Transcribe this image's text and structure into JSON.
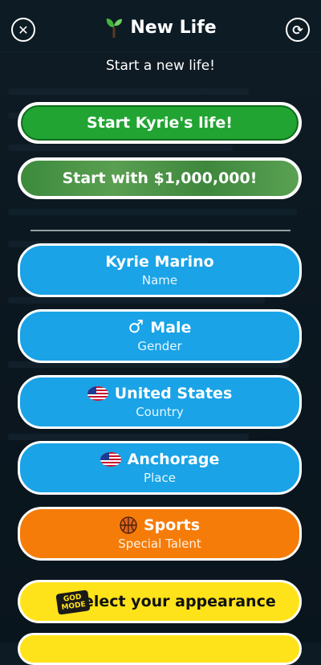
{
  "header": {
    "title": "New Life",
    "close_icon": "close-icon",
    "refresh_icon": "refresh-icon"
  },
  "subtitle": "Start a new life!",
  "primary_buttons": {
    "start_life": "Start Kyrie's life!",
    "start_million": "Start with $1,000,000!"
  },
  "options": [
    {
      "value": "Kyrie Marino",
      "label": "Name"
    },
    {
      "value": "Male",
      "label": "Gender",
      "icon": "male-icon"
    },
    {
      "value": "United States",
      "label": "Country",
      "icon": "us-flag-icon"
    },
    {
      "value": "Anchorage",
      "label": "Place",
      "icon": "us-flag-icon"
    },
    {
      "value": "Sports",
      "label": "Special Talent",
      "icon": "basketball-icon"
    }
  ],
  "appearance": {
    "label": "Select your appearance",
    "badge": "GOD MODE"
  },
  "colors": {
    "green": "#22a433",
    "blue": "#1aa3e6",
    "orange": "#f57c08",
    "yellow": "#ffe31a"
  }
}
